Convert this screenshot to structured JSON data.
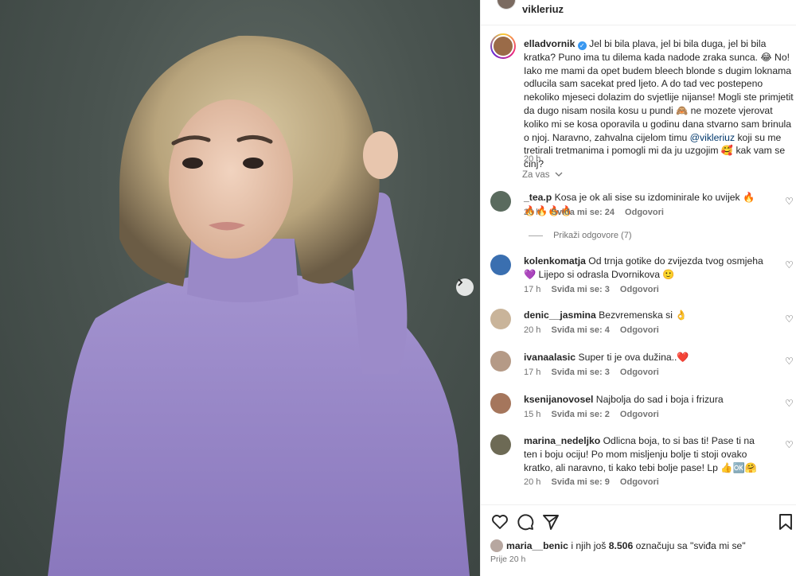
{
  "owner": {
    "username": "vikleriuz"
  },
  "caption": {
    "username": "elladvornik",
    "text_1": "Jel bi bila plava, jel bi bila duga, jel bi bila kratka? Puno ima tu dilema kada nadode zraka sunca. 😂 No! Iako me mami da opet budem bleech blonde s dugim loknama odlucila sam sacekat pred ljeto. A do tad vec postepeno nekoliko mjeseci dolazim do svjetlije nijanse! Mogli ste primjetit da dugo nisam nosila kosu u pundi 🙈 ne mozete vjerovat koliko mi se kosa oporavila u godinu dana stvarno sam brinula o njoj. Naravno, zahvalna cijelom timu",
    "mention": "@vikleriuz",
    "text_2": "koji su me tretirali tretmanima i pomogli mi da ju uzgojim 🥰 kak vam se cinj?",
    "time": "20 h"
  },
  "translate_label": "Za vas",
  "comments": [
    {
      "username": "_tea.p",
      "text": "Kosa je ok ali sise su izdominirale ko uvijek 🔥🔥🔥🔥🔥",
      "time": "20 h",
      "likes": "Sviđa mi se: 24",
      "reply": "Odgovori",
      "avatar_color": "#5a6b5e"
    },
    {
      "username": "kolenkomatja",
      "text": "Od trnja gotike do zvijezda tvog osmjeha 💜 Lijepo si odrasla Dvornikova 🙂",
      "time": "17 h",
      "likes": "Sviđa mi se: 3",
      "reply": "Odgovori",
      "avatar_color": "#3a6fb0"
    },
    {
      "username": "denic__jasmina",
      "text": "Bezvremenska si 👌",
      "time": "20 h",
      "likes": "Sviđa mi se: 4",
      "reply": "Odgovori",
      "avatar_color": "#c9b49a"
    },
    {
      "username": "ivanaalasic",
      "text": "Super ti je ova dužina..❤️",
      "time": "17 h",
      "likes": "Sviđa mi se: 3",
      "reply": "Odgovori",
      "avatar_color": "#b59a86"
    },
    {
      "username": "ksenijanovosel",
      "text": "Najbolja do sad i boja i frizura",
      "time": "15 h",
      "likes": "Sviđa mi se: 2",
      "reply": "Odgovori",
      "avatar_color": "#a5765c"
    },
    {
      "username": "marina_nedeljko",
      "text": "Odlicna boja, to si bas ti! Pase ti na ten i boju ociju! Po mom misljenju bolje ti stoji ovako kratko, ali naravno, ti kako tebi bolje pase! Lp 👍🆗🤗",
      "time": "20 h",
      "likes": "Sviđa mi se: 9",
      "reply": "Odgovori",
      "avatar_color": "#6d6a55"
    }
  ],
  "view_replies": "Prikaži odgovore (7)",
  "likes_line": {
    "user": "maria__benic",
    "middle": "i njih još",
    "count": "8.506",
    "tail": "označuju sa \"sviđa mi se\""
  },
  "posted_ago": "Prije 20 h"
}
